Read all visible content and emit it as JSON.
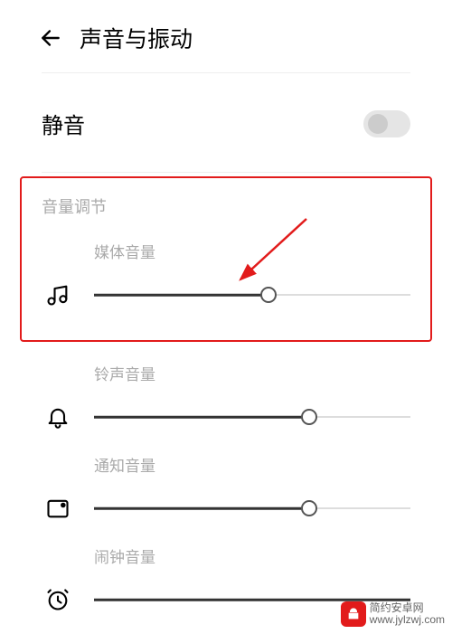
{
  "header": {
    "title": "声音与振动"
  },
  "mute": {
    "label": "静音",
    "enabled": false
  },
  "volume_section": {
    "header": "音量调节",
    "sliders": {
      "media": {
        "label": "媒体音量",
        "value": 55
      },
      "ringtone": {
        "label": "铃声音量",
        "value": 68
      },
      "notification": {
        "label": "通知音量",
        "value": 68
      },
      "alarm": {
        "label": "闹钟音量",
        "value": 100
      }
    }
  },
  "watermark": {
    "brand": "简约安卓网",
    "url": "www.jylzwj.com"
  }
}
